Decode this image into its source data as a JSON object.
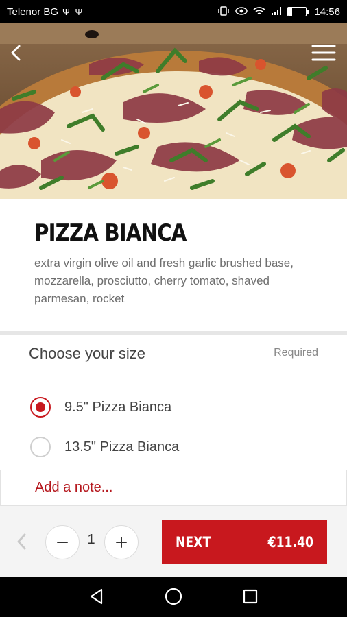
{
  "status_bar": {
    "carrier": "Telenor BG",
    "carrier_icons": "Ψ Ψ",
    "battery_level": "22",
    "time": "14:56"
  },
  "header": {
    "back_icon": "chevron-left-icon",
    "menu_icon": "hamburger-menu-icon"
  },
  "product": {
    "title": "PIZZA BIANCA",
    "description": "extra virgin olive oil and fresh garlic brushed base, mozzarella, prosciutto, cherry tomato, shaved parmesan, rocket"
  },
  "size_section": {
    "heading": "Choose your size",
    "required_label": "Required",
    "options": [
      {
        "label": "9.5\" Pizza Bianca",
        "selected": true
      },
      {
        "label": "13.5\" Pizza Bianca",
        "selected": false
      }
    ]
  },
  "note": {
    "placeholder": "Add a note..."
  },
  "order_bar": {
    "quantity": "1",
    "minus_symbol": "−",
    "plus_symbol": "+",
    "next_label": "NEXT",
    "price": "€11.40"
  },
  "colors": {
    "accent": "#c8181e",
    "note_text": "#b5171d"
  }
}
